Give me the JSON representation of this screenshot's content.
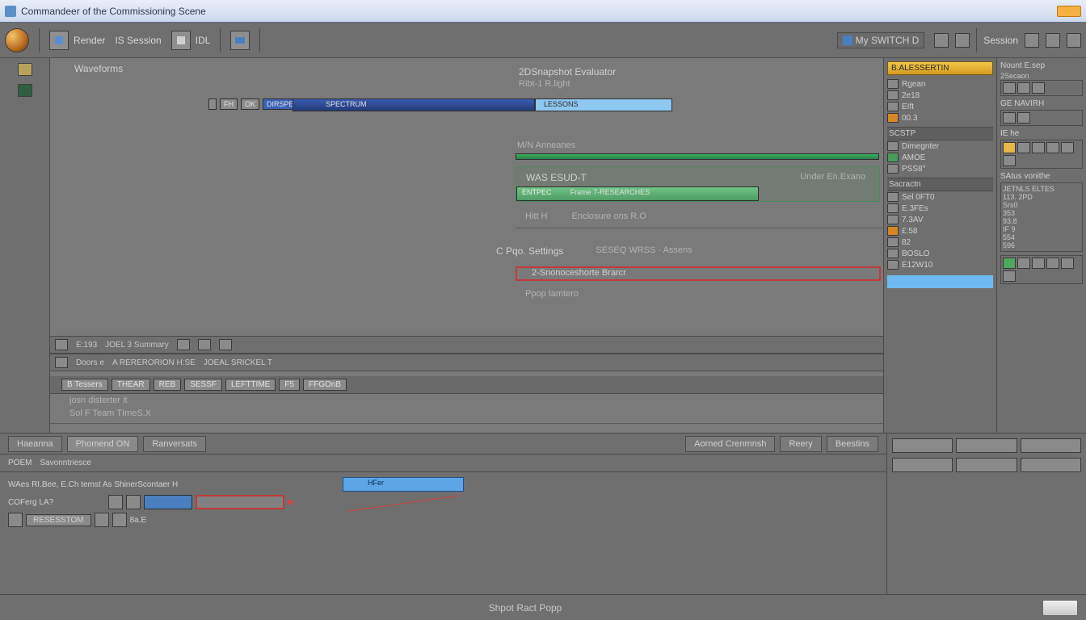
{
  "window": {
    "title": "Commandeer of the Commissioning Scene"
  },
  "toolbar": {
    "btn_render": "Render",
    "btn_session": "IS Session",
    "btn_idl": "IDL",
    "combo_main": "My SWITCH D",
    "tab_session": "Session"
  },
  "canvas": {
    "header_label": "Waveforms",
    "blue_track_left_chips": [
      "FH",
      "OK",
      "DIRSPECTM"
    ],
    "blue_track_mid": "SPECTRUM",
    "blue_track_right": "LESSONS",
    "group2_title": "2DSnapshot Evaluator",
    "group2_sub": "Ribt-1   R.light",
    "group2_row_b": "M/N  Anneanes",
    "green_row1_label": "WAS ESUD-T",
    "green_row1_right": "Under En.Exano",
    "green_row2_left": "ENTPEC",
    "green_row2_mid": "Frame  7-RESEARCHES",
    "gray_row_left": "Hitt H",
    "gray_row_right": "Enclosure ons R.O",
    "c_header_left": "C  Pqo. Settings",
    "c_header_right": "SESEQ WRSS - Assens",
    "red_row_label": "2-Snonoceshorte Brarcr",
    "prop_row_label": "Ppop tamtero",
    "midinfo_a": "E:193",
    "midinfo_b": "JOEL  3   Summary",
    "midinfo_c": "Doors e",
    "midinfo_d": "A RERERORION H:SE",
    "midinfo_e": "JOEAL SRICKEL T",
    "secbar": [
      "B Tessers",
      "THEAR",
      "REB",
      "SESSF",
      "LEFTTIME",
      "F5",
      "FFGOnB"
    ],
    "secline1": "josn    disterter it",
    "secline2": "Sol    F Team TImeS.X"
  },
  "panelA": {
    "tab": "B.ALESSERTIN",
    "items1": [
      {
        "icon": "grid",
        "label": "Rgean"
      },
      {
        "icon": "plain",
        "label": "2e18"
      },
      {
        "icon": "plain",
        "label": "EIft"
      },
      {
        "icon": "or",
        "label": "00.3"
      }
    ],
    "sub1": "SCSTP",
    "items2": [
      {
        "icon": "plain",
        "label": "Dimegnter"
      },
      {
        "icon": "gr",
        "label": "AMOE"
      },
      {
        "icon": "plain",
        "label": "PSS8°"
      }
    ],
    "sub2": "Sacractn",
    "items3": [
      {
        "icon": "plain",
        "label": "Sel 0FT0"
      },
      {
        "icon": "plain",
        "label": "E.3FEs"
      },
      {
        "icon": "plain",
        "label": "7.3AV"
      },
      {
        "icon": "y",
        "label": "£:58"
      },
      {
        "icon": "plain",
        "label": "82"
      },
      {
        "icon": "plain",
        "label": "BOSLO"
      },
      {
        "icon": "plain",
        "label": "E12W10"
      }
    ]
  },
  "panelB": {
    "hdr1": "Nount  E.sep",
    "hdr1b": "2Secaon",
    "blk2_hdr": "GE NAVIRH",
    "blk3_hdr": "IE he",
    "blk4_hdr": "SAtus vonithe",
    "blk4_items": [
      "JETNLS ELTES",
      "113. 2PD",
      "Srs0",
      "353",
      "93.8",
      "IF 9",
      "554",
      "596"
    ]
  },
  "timeline": {
    "tabs": [
      "Haeanna",
      "Phomend ON",
      "Ranversats"
    ],
    "tabs2": [
      "Aorned Crenmnsh",
      "Reery",
      "Beestins"
    ],
    "sub_a": "POEM",
    "sub_b": "Savonntriesce",
    "row1_left": "WAes  RI.Bee,   E.Ch temst  As ShinerScontaer  H",
    "row1_clip": "HFer",
    "row2_left": "COFerg  LA?",
    "row3_left": "RESESSTOM",
    "row3_right": "8a.E"
  },
  "status": {
    "center": "Shpot Ract Popp"
  }
}
